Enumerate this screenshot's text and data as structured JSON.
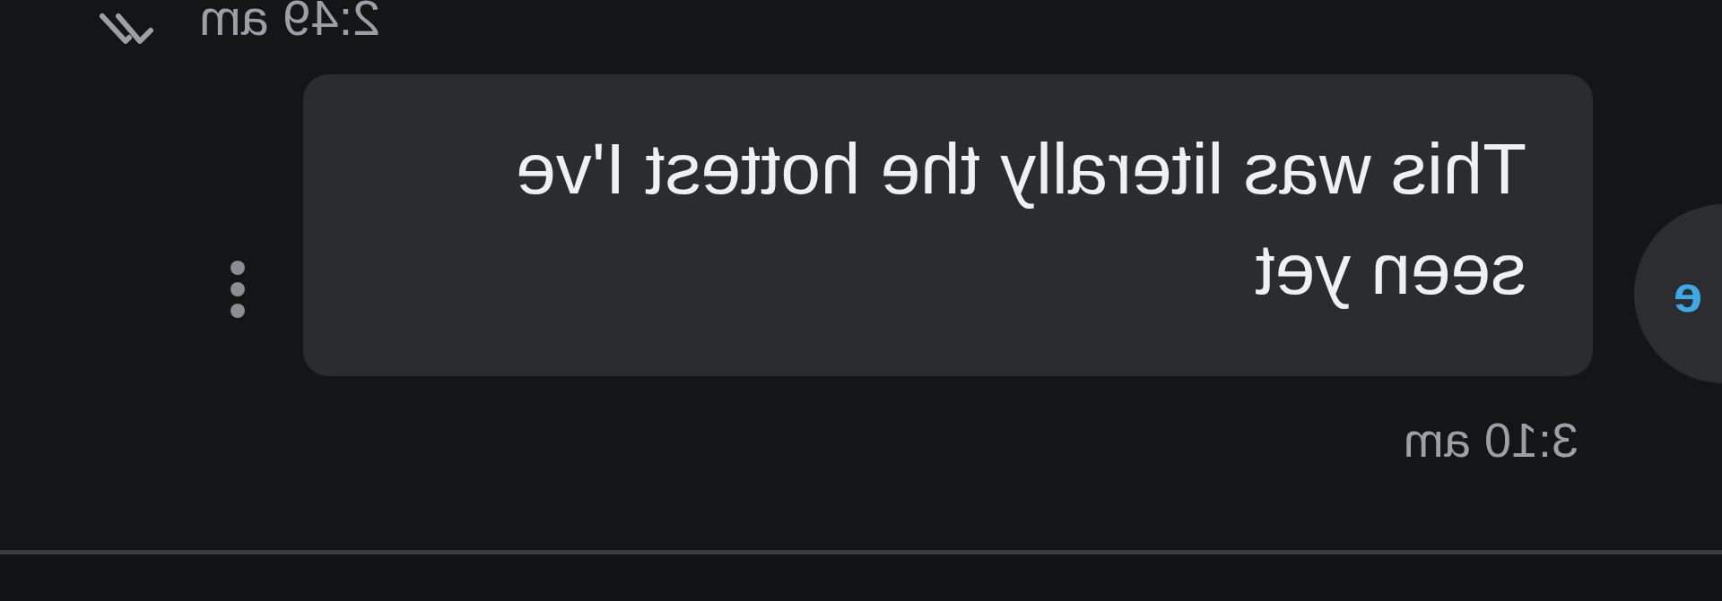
{
  "previous_message": {
    "time": "2:49 am",
    "read": true
  },
  "message": {
    "avatar_letters": "e",
    "text": "This was literally the hottest I've seen yet",
    "time": "3:10 am"
  }
}
